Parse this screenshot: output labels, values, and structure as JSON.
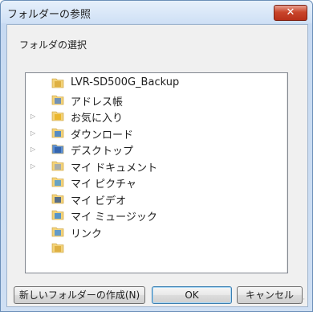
{
  "dialog": {
    "title": "フォルダーの参照",
    "close_icon": "close-icon",
    "prompt": "フォルダの選択"
  },
  "tree": {
    "items": [
      {
        "label": "LVR-SD500G_Backup",
        "expandable": false,
        "icon": "folder-icon"
      },
      {
        "label": "アドレス帳",
        "expandable": false,
        "icon": "address-book-folder-icon"
      },
      {
        "label": "お気に入り",
        "expandable": true,
        "icon": "favorites-folder-icon"
      },
      {
        "label": "ダウンロード",
        "expandable": true,
        "icon": "downloads-folder-icon"
      },
      {
        "label": "デスクトップ",
        "expandable": true,
        "icon": "desktop-folder-icon"
      },
      {
        "label": "マイ ドキュメント",
        "expandable": true,
        "icon": "documents-folder-icon"
      },
      {
        "label": "マイ ピクチャ",
        "expandable": false,
        "icon": "pictures-folder-icon"
      },
      {
        "label": "マイ ビデオ",
        "expandable": false,
        "icon": "videos-folder-icon"
      },
      {
        "label": "マイ ミュージック",
        "expandable": false,
        "icon": "music-folder-icon"
      },
      {
        "label": "リンク",
        "expandable": false,
        "icon": "links-folder-icon"
      },
      {
        "label": "",
        "expandable": false,
        "icon": "folder-icon"
      }
    ],
    "scroll_up_icon": "scroll-up-icon",
    "scroll_down_icon": "scroll-down-icon"
  },
  "buttons": {
    "new_folder": "新しいフォルダーの作成(N)",
    "ok": "OK",
    "cancel": "キャンセル"
  }
}
